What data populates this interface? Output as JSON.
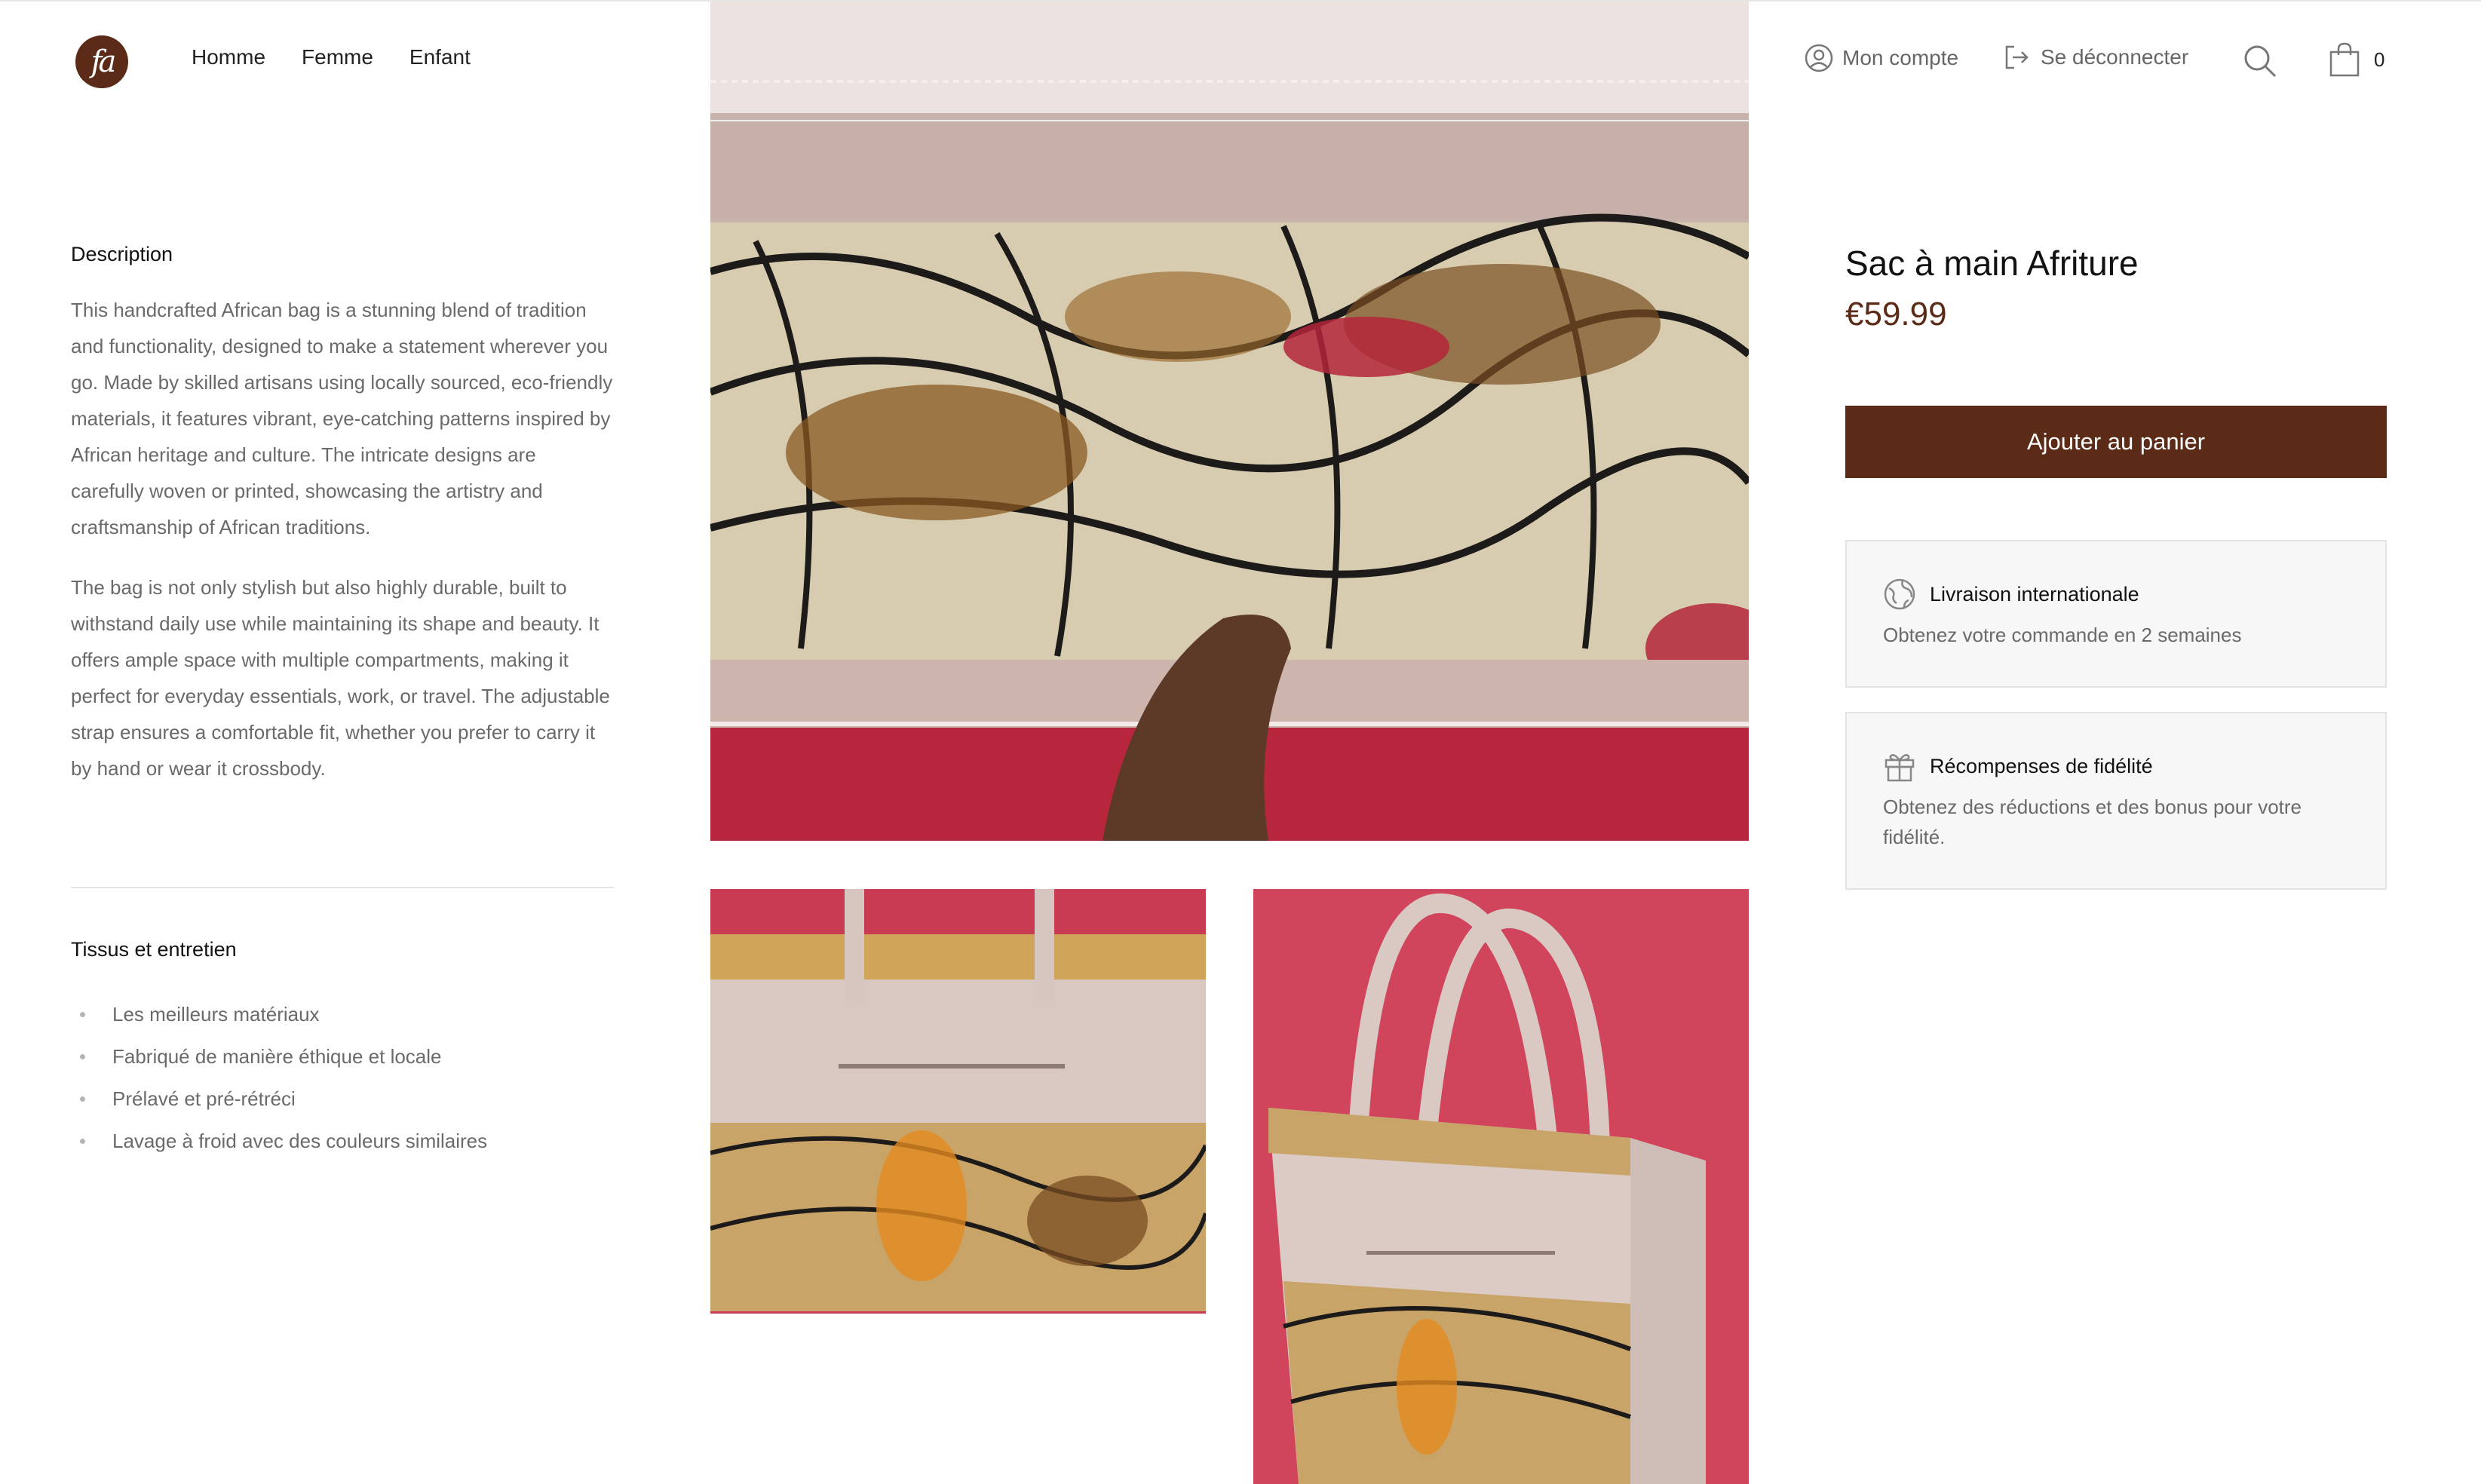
{
  "header": {
    "logo_text": "fa",
    "nav": [
      "Homme",
      "Femme",
      "Enfant"
    ],
    "account_label": "Mon compte",
    "logout_label": "Se déconnecter",
    "cart_count": "0"
  },
  "description": {
    "heading": "Description",
    "paragraphs": [
      "This handcrafted African bag is a stunning blend of tradition and functionality, designed to make a statement wherever you go. Made by skilled artisans using locally sourced, eco-friendly materials, it features vibrant, eye-catching patterns inspired by African heritage and culture. The intricate designs are carefully woven or printed, showcasing the artistry and craftsmanship of African traditions.",
      "The bag is not only stylish but also highly durable, built to withstand daily use while maintaining its shape and beauty. It offers ample space with multiple compartments, making it perfect for everyday essentials, work, or travel. The adjustable strap ensures a comfortable fit, whether you prefer to carry it by hand or wear it crossbody."
    ]
  },
  "care": {
    "heading": "Tissus et entretien",
    "items": [
      "Les meilleurs matériaux",
      "Fabriqué de manière éthique et locale",
      "Prélavé et pré-rétréci",
      "Lavage à froid avec des couleurs similaires"
    ]
  },
  "product": {
    "title": "Sac à main Afriture",
    "price": "€59.99",
    "add_to_cart_label": "Ajouter au panier"
  },
  "info_cards": [
    {
      "title": "Livraison internationale",
      "text": "Obtenez votre commande en 2 semaines",
      "icon": "globe-icon"
    },
    {
      "title": "Récompenses de fidélité",
      "text": "Obtenez des réductions et des bonus pour votre fidélité.",
      "icon": "gift-icon"
    }
  ],
  "colors": {
    "brand": "#5c2b17",
    "background_wall": "#c5384f",
    "bag_leather": "#cdb6b0"
  }
}
